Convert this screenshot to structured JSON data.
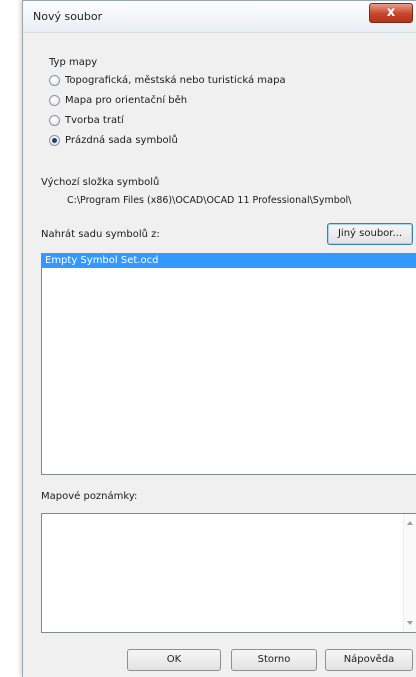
{
  "window": {
    "title": "Nový soubor",
    "close_glyph": "x"
  },
  "map_type": {
    "label": "Typ mapy",
    "options": [
      {
        "label": "Topografická, městská nebo turistická mapa",
        "checked": false
      },
      {
        "label": "Mapa pro orientační běh",
        "checked": false
      },
      {
        "label": "Tvorba tratí",
        "checked": false
      },
      {
        "label": "Prázdná sada symbolů",
        "checked": true
      }
    ]
  },
  "symbol_folder": {
    "label": "Výchozí složka symbolů",
    "path": "C:\\Program Files (x86)\\OCAD\\OCAD 11 Professional\\Symbol\\"
  },
  "load_symbols": {
    "label": "Nahrát sadu symbolů z:",
    "other_file_button": "Jiný soubor...",
    "items": [
      {
        "name": "Empty Symbol Set.ocd",
        "selected": true
      }
    ]
  },
  "notes": {
    "label": "Mapové poznámky:",
    "value": ""
  },
  "buttons": {
    "ok": "OK",
    "cancel": "Storno",
    "help": "Nápověda"
  },
  "colors": {
    "selection": "#3399ff",
    "close_button": "#c7442b"
  }
}
